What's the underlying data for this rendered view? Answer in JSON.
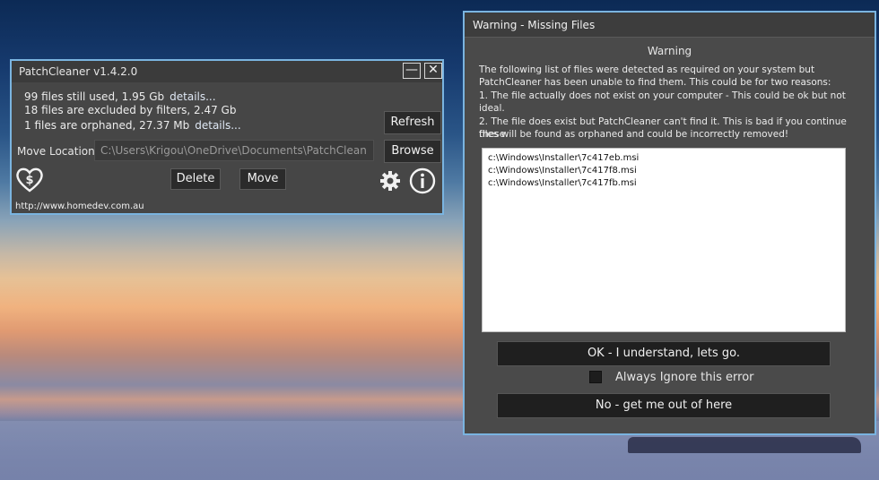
{
  "main_window": {
    "title": "PatchCleaner v1.4.2.0",
    "min_glyph": "—",
    "close_glyph": "✕",
    "stats": [
      {
        "text": "99 files still used, 1.95 Gb",
        "link": "details..."
      },
      {
        "text": "18 files are excluded by filters, 2.47 Gb",
        "link": ""
      },
      {
        "text": "1 files are orphaned, 27.37 Mb",
        "link": "details..."
      }
    ],
    "refresh_label": "Refresh",
    "move_location_label": "Move Location",
    "move_location_value": "C:\\Users\\Krigou\\OneDrive\\Documents\\PatchClean",
    "browse_label": "Browse",
    "delete_label": "Delete",
    "move_label": "Move",
    "url": "http://www.homedev.com.au",
    "icons": [
      "donate-heart-icon",
      "gear-icon",
      "info-icon"
    ]
  },
  "warning_window": {
    "title": "Warning - Missing Files",
    "heading": "Warning",
    "message_lines": [
      "The following list of files were detected as required on your system but",
      "PatchCleaner has been unable to find them. This could be for two reasons:",
      "1. The file actually does not exist on your computer - This could be ok but not",
      "ideal.",
      "2. The file does exist but PatchCleaner can't find it. This is bad if you continue these",
      "files will be found as orphaned and could be incorrectly removed!"
    ],
    "files": [
      "c:\\Windows\\Installer\\7c417eb.msi",
      "c:\\Windows\\Installer\\7c417f8.msi",
      "c:\\Windows\\Installer\\7c417fb.msi"
    ],
    "ok_label": "OK - I understand, lets go.",
    "ignore_label": "Always Ignore this error",
    "ignore_checked": false,
    "no_label": "No - get me out of here"
  },
  "colors": {
    "window_border": "#7ab4e0",
    "window_bg": "#464646",
    "button_bg": "#2b2b2b"
  }
}
